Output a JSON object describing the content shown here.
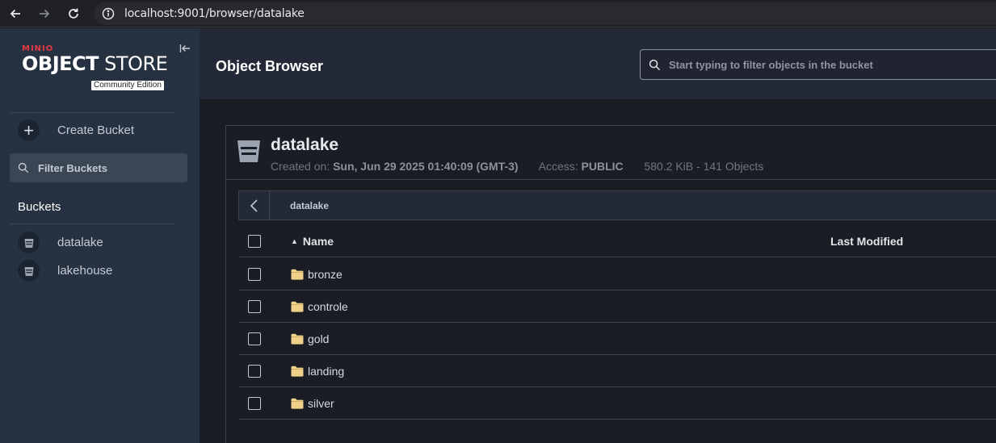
{
  "browser": {
    "url": "localhost:9001/browser/datalake"
  },
  "sidebar": {
    "brand": {
      "minio": "MINIO",
      "object": "OBJECT",
      "store": "STORE",
      "edition": "Community Edition"
    },
    "create_bucket_label": "Create Bucket",
    "filter_placeholder": "Filter Buckets",
    "buckets_title": "Buckets",
    "buckets": [
      {
        "label": "datalake"
      },
      {
        "label": "lakehouse"
      }
    ]
  },
  "header": {
    "title": "Object Browser",
    "search_placeholder": "Start typing to filter objects in the bucket"
  },
  "bucket": {
    "name": "datalake",
    "created_label": "Created on:",
    "created_value": "Sun, Jun 29 2025 01:40:09 (GMT-3)",
    "access_label": "Access:",
    "access_value": "PUBLIC",
    "usage": "580.2 KiB - 141 Objects"
  },
  "listing": {
    "breadcrumb": "datalake",
    "columns": {
      "name": "Name",
      "modified": "Last Modified"
    },
    "items": [
      {
        "name": "bronze"
      },
      {
        "name": "controle"
      },
      {
        "name": "gold"
      },
      {
        "name": "landing"
      },
      {
        "name": "silver"
      }
    ]
  },
  "colors": {
    "sidebar_bg": "#263141",
    "header_bg": "#232936",
    "main_bg": "#1a1d24",
    "brand_red": "#e73844",
    "folder_yellow": "#f0d18a"
  }
}
